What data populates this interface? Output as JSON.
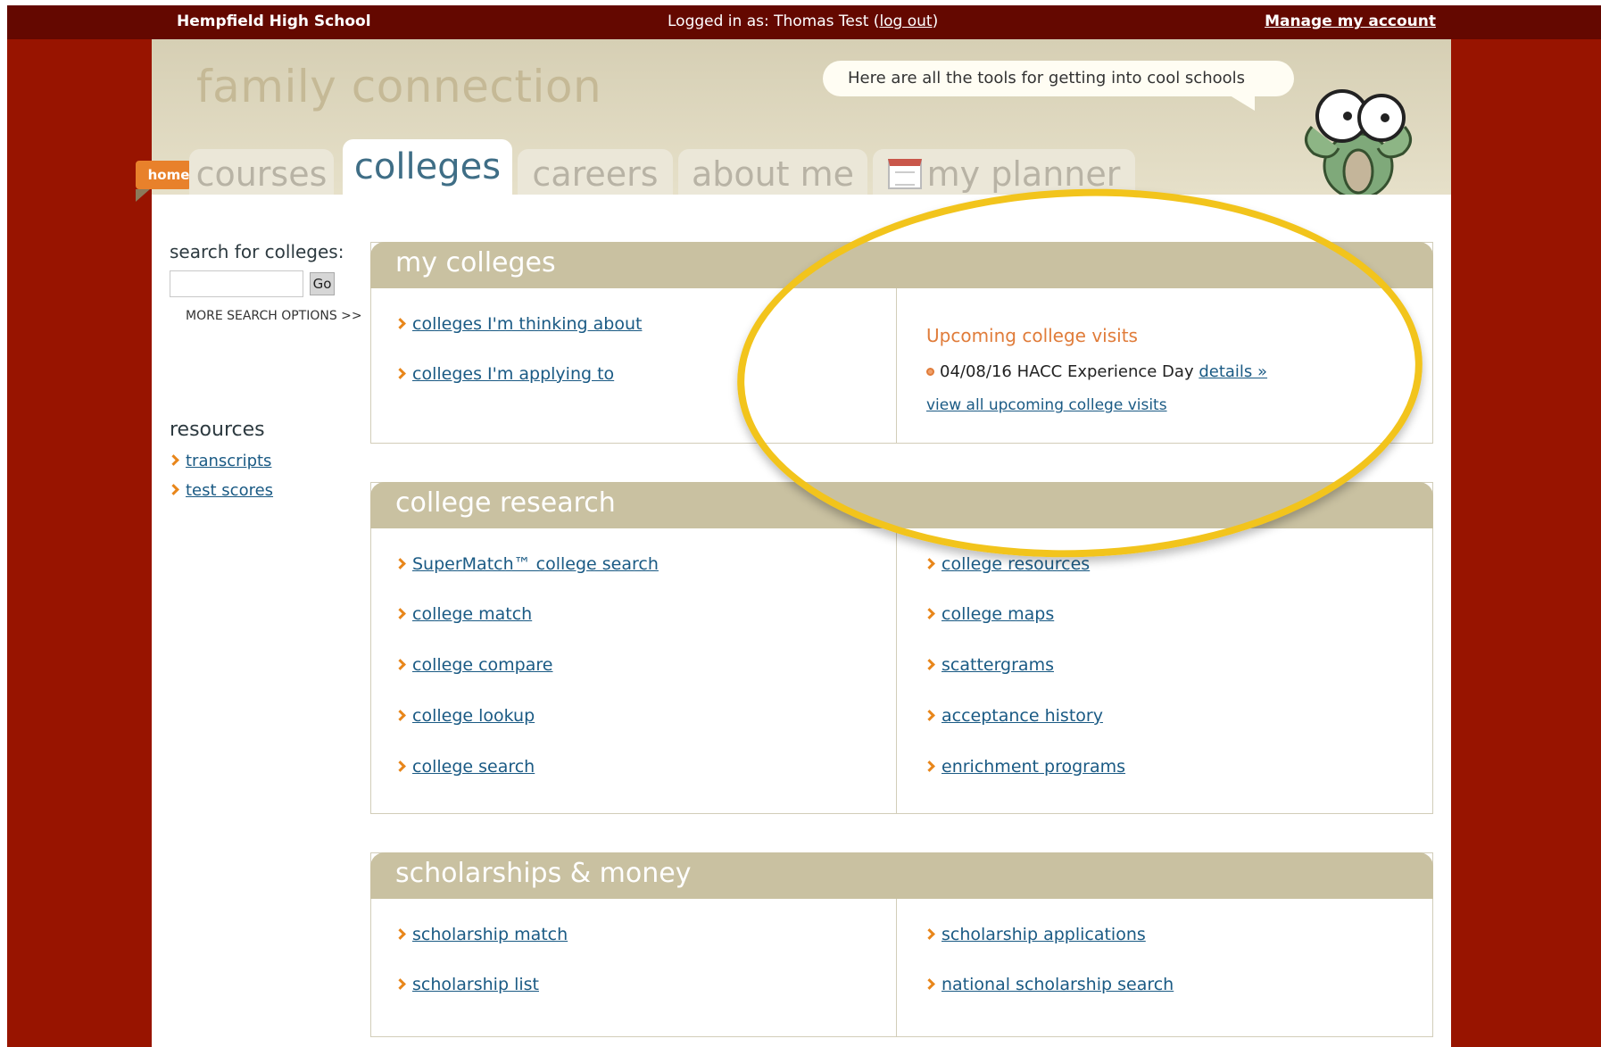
{
  "topbar": {
    "school": "Hempfield High School",
    "logged_in_prefix": "Logged in as: Thomas Test (",
    "logout": "log out",
    "logged_in_suffix": ")",
    "manage_account": "Manage my account"
  },
  "header": {
    "brand": "family connection",
    "tagline": "Here are all the tools for getting into cool schools"
  },
  "tabs": {
    "home": "home",
    "courses": "courses",
    "colleges": "colleges",
    "careers": "careers",
    "about_me": "about me",
    "my_planner": "my planner"
  },
  "sidebar": {
    "search_label": "search for colleges:",
    "go": "Go",
    "more_search": "MORE SEARCH OPTIONS >>",
    "resources_title": "resources",
    "resources": [
      "transcripts",
      "test scores"
    ]
  },
  "my_colleges": {
    "title": "my colleges",
    "links": [
      "colleges I'm thinking about",
      "colleges I'm applying to"
    ],
    "visits_title": "Upcoming college visits",
    "visit": "04/08/16 HACC Experience Day",
    "visit_details": "details »",
    "view_all": "view all upcoming college visits"
  },
  "college_research": {
    "title": "college research",
    "left": [
      "SuperMatch™ college search",
      "college match",
      "college compare",
      "college lookup",
      "college search"
    ],
    "right": [
      "college resources",
      "college maps",
      "scattergrams",
      "acceptance history",
      "enrichment programs"
    ]
  },
  "scholarships": {
    "title": "scholarships & money",
    "left": [
      "scholarship match",
      "scholarship list"
    ],
    "right": [
      "scholarship applications",
      "national scholarship search"
    ]
  }
}
